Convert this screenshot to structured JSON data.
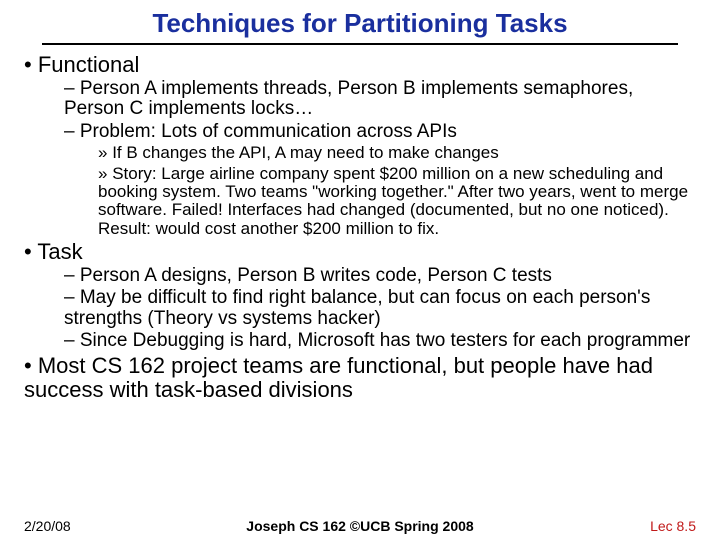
{
  "title": "Techniques for Partitioning Tasks",
  "b1": {
    "head": "Functional",
    "s1": "Person A implements threads, Person B implements semaphores, Person C implements locks…",
    "s2": "Problem: Lots of communication across APIs",
    "s2a": "If B changes the API, A may need to make changes",
    "s2b": "Story: Large airline company spent $200 million on a new scheduling and booking system. Two teams \"working together.\" After two years, went to merge software. Failed! Interfaces had changed (documented, but no one noticed). Result: would cost another $200 million to fix."
  },
  "b2": {
    "head": "Task",
    "s1": "Person A designs, Person B writes code, Person C tests",
    "s2": "May be difficult to find right balance, but can focus on each person's strengths (Theory vs systems hacker)",
    "s3": "Since Debugging is hard, Microsoft has two testers for each programmer"
  },
  "b3": {
    "head": "Most CS 162 project teams are functional, but people have had success with task-based divisions"
  },
  "footer": {
    "left": "2/20/08",
    "center": "Joseph CS 162 ©UCB Spring 2008",
    "right": "Lec 8.5"
  }
}
